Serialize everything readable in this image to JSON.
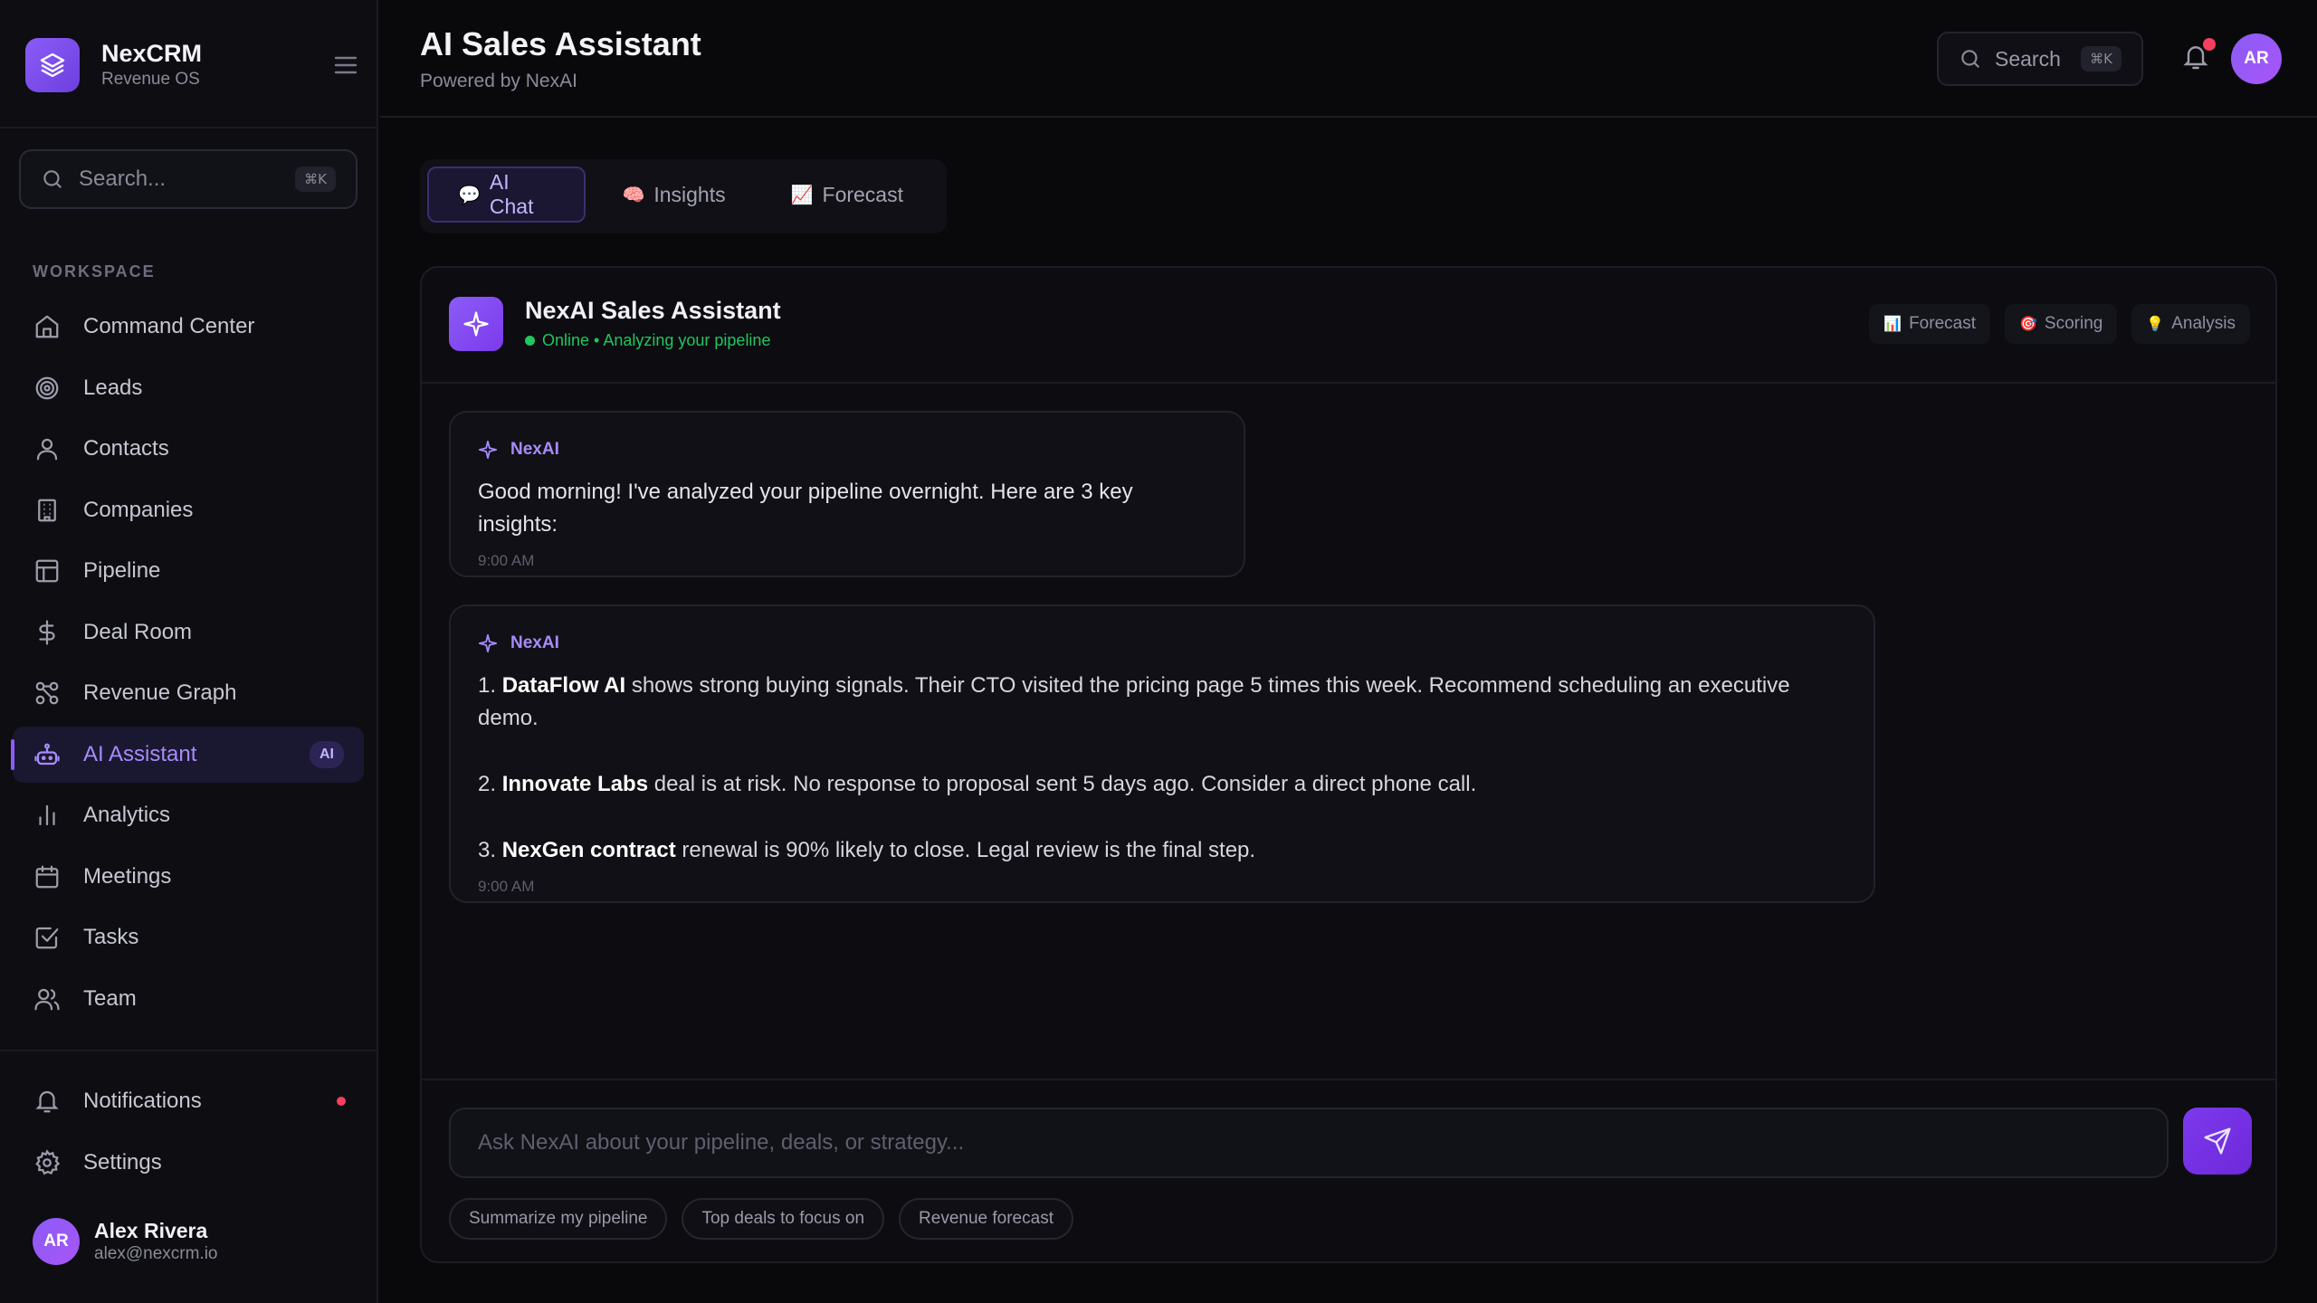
{
  "brand": {
    "name": "NexCRM",
    "subtitle": "Revenue OS"
  },
  "sidebar": {
    "search_placeholder": "Search...",
    "search_shortcut": "⌘K",
    "section_label": "WORKSPACE",
    "items": [
      {
        "label": "Command Center",
        "icon": "home-icon"
      },
      {
        "label": "Leads",
        "icon": "target-icon"
      },
      {
        "label": "Contacts",
        "icon": "user-icon"
      },
      {
        "label": "Companies",
        "icon": "building-icon"
      },
      {
        "label": "Pipeline",
        "icon": "layout-icon"
      },
      {
        "label": "Deal Room",
        "icon": "dollar-icon"
      },
      {
        "label": "Revenue Graph",
        "icon": "graph-icon"
      },
      {
        "label": "AI Assistant",
        "icon": "bot-icon",
        "active": true,
        "badge": "AI"
      },
      {
        "label": "Analytics",
        "icon": "bar-chart-icon"
      },
      {
        "label": "Meetings",
        "icon": "calendar-icon"
      },
      {
        "label": "Tasks",
        "icon": "checkbox-icon"
      },
      {
        "label": "Team",
        "icon": "users-icon"
      }
    ],
    "bottom_items": [
      {
        "label": "Notifications",
        "icon": "bell-icon",
        "has_dot": true
      },
      {
        "label": "Settings",
        "icon": "gear-icon"
      }
    ],
    "user": {
      "initials": "AR",
      "name": "Alex Rivera",
      "email": "alex@nexcrm.io"
    }
  },
  "header": {
    "title": "AI Sales Assistant",
    "subtitle": "Powered by NexAI",
    "search_label": "Search",
    "search_shortcut": "⌘K",
    "avatar_initials": "AR"
  },
  "tabs": [
    {
      "label": "AI Chat",
      "emoji": "💬",
      "active": true
    },
    {
      "label": "Insights",
      "emoji": "🧠"
    },
    {
      "label": "Forecast",
      "emoji": "📈"
    }
  ],
  "chat": {
    "bot_name": "NexAI Sales Assistant",
    "status": "Online • Analyzing your pipeline",
    "chips": [
      {
        "label": "Forecast",
        "emoji": "📊"
      },
      {
        "label": "Scoring",
        "emoji": "🎯"
      },
      {
        "label": "Analysis",
        "emoji": "💡"
      }
    ],
    "messages": [
      {
        "sender": "NexAI",
        "text": "Good morning! I've analyzed your pipeline overnight. Here are 3 key insights:",
        "time": "9:00 AM"
      },
      {
        "sender": "NexAI",
        "insights": [
          {
            "num": "1.",
            "bold": "DataFlow AI",
            "rest": "shows strong buying signals. Their CTO visited the pricing page 5 times this week. Recommend scheduling an executive demo."
          },
          {
            "num": "2.",
            "bold": "Innovate Labs",
            "rest": "deal is at risk. No response to proposal sent 5 days ago. Consider a direct phone call."
          },
          {
            "num": "3.",
            "bold": "NexGen contract",
            "rest": "renewal is 90% likely to close. Legal review is the final step."
          }
        ],
        "time": "9:00 AM"
      }
    ],
    "input_placeholder": "Ask NexAI about your pipeline, deals, or strategy...",
    "suggestions": [
      "Summarize my pipeline",
      "Top deals to focus on",
      "Revenue forecast"
    ]
  },
  "colors": {
    "accent": "#8b5cf6",
    "accent_text": "#a78bfa",
    "online": "#22c55e",
    "alert": "#f43f5e",
    "background": "#09090c"
  }
}
